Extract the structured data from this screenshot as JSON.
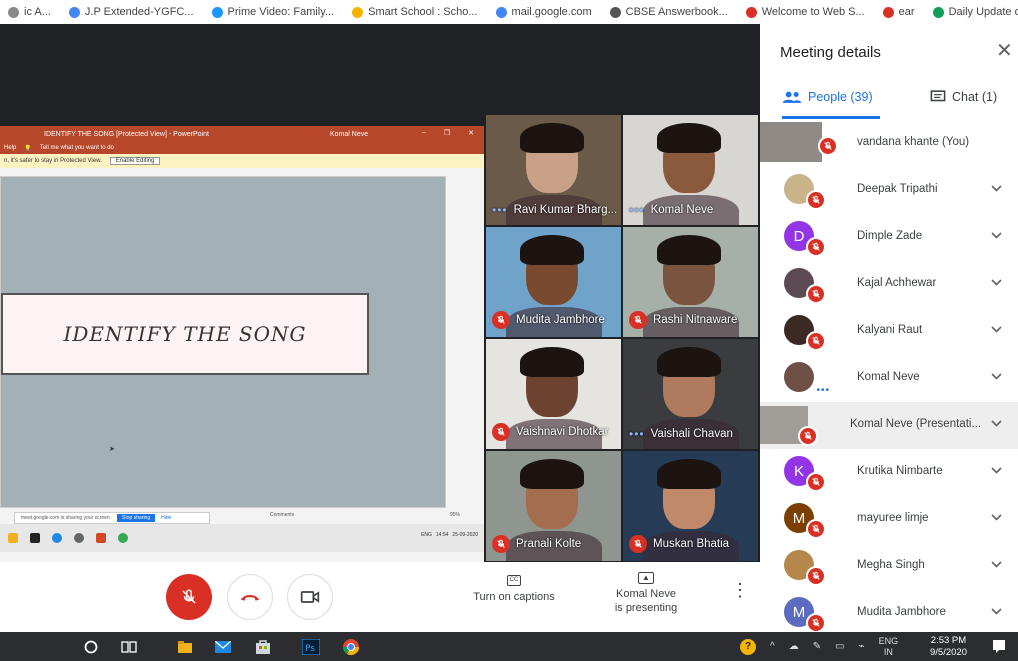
{
  "bookmarks": [
    {
      "label": "ic A...",
      "icon": "page-icon",
      "color": "#888888"
    },
    {
      "label": "J.P Extended-YGFC...",
      "icon": "google-icon",
      "color": "#4285f4"
    },
    {
      "label": "Prime Video: Family...",
      "icon": "prime-icon",
      "color": "#1a98ff"
    },
    {
      "label": "Smart School : Scho...",
      "icon": "school-icon",
      "color": "#f4b400"
    },
    {
      "label": "mail.google.com",
      "icon": "google-icon",
      "color": "#4285f4"
    },
    {
      "label": "CBSE Answerbook...",
      "icon": "cbse-icon",
      "color": "#555555"
    },
    {
      "label": "Welcome to Web S...",
      "icon": "web-icon",
      "color": "#d93025"
    },
    {
      "label": "ear",
      "icon": "mail-icon",
      "color": "#d93025"
    },
    {
      "label": "Daily Update of Cla...",
      "icon": "daily-icon",
      "color": "#0f9d58"
    }
  ],
  "presentation": {
    "window_title": "IDENTIFY THE SONG [Protected View] - PowerPoint",
    "user": "Komal Neve",
    "menu": [
      "Help",
      "Tell me what you want to do"
    ],
    "protected_notice": "n, it's safer to stay in Protected View.",
    "enable_editing": "Enable Editing",
    "slide_text": "IDENTIFY THE SONG",
    "share_notice": "meet.google.com is sharing your screen.",
    "stop_sharing": "Stop sharing",
    "hide": "Hide",
    "comments": "Comments",
    "zoom": "95%",
    "inner_clock_time": "14:54",
    "inner_clock_date": "25-09-2020",
    "inner_lang": "ENG"
  },
  "tiles": [
    {
      "name": "Ravi Kumar Bharg...",
      "status": "speaking",
      "bg": "#6b5a4a",
      "skin": "#c9a088"
    },
    {
      "name": "Komal Neve",
      "status": "speaking",
      "bg": "#d8d6d2",
      "skin": "#8a5a3c"
    },
    {
      "name": "Mudita Jambhore",
      "status": "muted",
      "bg": "#6fa3c9",
      "skin": "#7a4a30"
    },
    {
      "name": "Rashi Nitnaware",
      "status": "muted",
      "bg": "#a7b0a8",
      "skin": "#7b5440"
    },
    {
      "name": "Vaishnavi Dhotkar",
      "status": "muted",
      "bg": "#e6e4e0",
      "skin": "#6b4330"
    },
    {
      "name": "Vaishali Chavan",
      "status": "speaking",
      "bg": "#3a3c40",
      "skin": "#b07a5e"
    },
    {
      "name": "Pranali Kolte",
      "status": "muted",
      "bg": "#8f9690",
      "skin": "#a46d4e"
    },
    {
      "name": "Muskan Bhatia",
      "status": "muted",
      "bg": "#253b56",
      "skin": "#c08a6a"
    }
  ],
  "controls": {
    "captions_label": "Turn on captions",
    "captions_icon": "CC",
    "presenting_line1": "Komal Neve",
    "presenting_line2": "is presenting",
    "more": "⋮"
  },
  "panel": {
    "title": "Meeting details",
    "close": "✕",
    "people_tab": "People (39)",
    "chat_tab": "Chat (1)",
    "people": [
      {
        "name": "vandana khante (You)",
        "avatar": "photo",
        "color": "#8f8a86",
        "initial": "",
        "state": "muted",
        "chevron": false
      },
      {
        "name": "Deepak Tripathi",
        "avatar": "photo",
        "color": "#c9b48a",
        "initial": "",
        "state": "muted",
        "chevron": true
      },
      {
        "name": "Dimple Zade",
        "avatar": "letter",
        "color": "#9334e6",
        "initial": "D",
        "state": "muted",
        "chevron": true
      },
      {
        "name": "Kajal Achhewar",
        "avatar": "photo",
        "color": "#5b4a52",
        "initial": "",
        "state": "muted",
        "chevron": true
      },
      {
        "name": "Kalyani Raut",
        "avatar": "photo",
        "color": "#3b2a24",
        "initial": "",
        "state": "muted",
        "chevron": true
      },
      {
        "name": "Komal Neve",
        "avatar": "photo",
        "color": "#6e5046",
        "initial": "",
        "state": "speaking",
        "chevron": true
      },
      {
        "name": "Komal Neve (Presentati...",
        "avatar": "photo",
        "color": "#a09c98",
        "initial": "",
        "state": "muted",
        "chevron": true
      },
      {
        "name": "Krutika Nimbarte",
        "avatar": "letter",
        "color": "#9334e6",
        "initial": "K",
        "state": "muted",
        "chevron": true
      },
      {
        "name": "mayuree limje",
        "avatar": "letter",
        "color": "#7b3f00",
        "initial": "M",
        "state": "muted",
        "chevron": true
      },
      {
        "name": "Megha Singh",
        "avatar": "photo",
        "color": "#b5874a",
        "initial": "",
        "state": "muted",
        "chevron": true
      },
      {
        "name": "Mudita Jambhore",
        "avatar": "letter",
        "color": "#5c6bc0",
        "initial": "M",
        "state": "muted",
        "chevron": true
      }
    ]
  },
  "taskbar": {
    "lang": "ENG",
    "region": "IN",
    "time": "2:53 PM",
    "date": "9/5/2020"
  }
}
